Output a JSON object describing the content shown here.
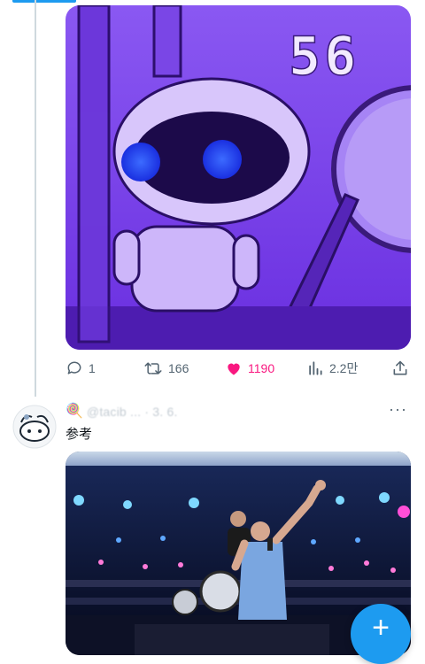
{
  "tweet1": {
    "media": {
      "overlay_text": "56"
    },
    "actions": {
      "reply_count": "1",
      "retweet_count": "166",
      "like_count": "1190",
      "views_count": "2.2만"
    }
  },
  "tweet2": {
    "badge_emoji": "🍭",
    "handle": "@tacib ... · 3. 6.",
    "more_label": "···",
    "text": "参考"
  },
  "fab": {
    "label": "+"
  },
  "colors": {
    "accent": "#1d9bf0",
    "like": "#f91880",
    "muted": "#536471",
    "media_purple": "#7b3ff0"
  }
}
